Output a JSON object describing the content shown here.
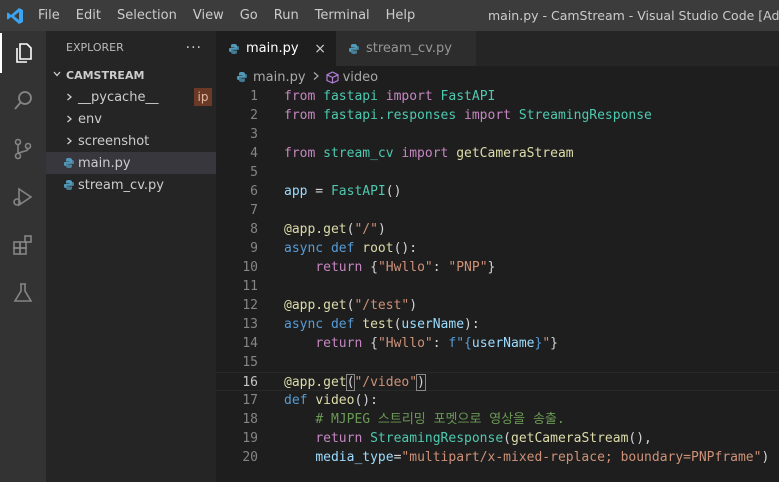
{
  "titlebar": {
    "menu": [
      "File",
      "Edit",
      "Selection",
      "View",
      "Go",
      "Run",
      "Terminal",
      "Help"
    ],
    "window_title": "main.py - CamStream - Visual Studio Code [Administrator]"
  },
  "activity_bar": {
    "items": [
      "explorer-icon",
      "search-icon",
      "source-control-icon",
      "run-debug-icon",
      "extensions-icon",
      "testing-icon"
    ],
    "active": "explorer-icon"
  },
  "explorer": {
    "title": "EXPLORER",
    "more": "···",
    "folder": "CAMSTREAM",
    "items": [
      {
        "label": "__pycache__",
        "type": "folder"
      },
      {
        "label": "env",
        "type": "folder"
      },
      {
        "label": "screenshot",
        "type": "folder"
      },
      {
        "label": "main.py",
        "type": "python"
      },
      {
        "label": "stream_cv.py",
        "type": "python"
      }
    ],
    "badge": "ip"
  },
  "tabs": [
    {
      "label": "main.py",
      "active": true,
      "close": "×"
    },
    {
      "label": "stream_cv.py",
      "active": false
    }
  ],
  "breadcrumb": {
    "file": "main.py",
    "symbol": "video"
  },
  "code": {
    "line_numbers": [
      "1",
      "2",
      "3",
      "4",
      "5",
      "6",
      "7",
      "8",
      "9",
      "10",
      "11",
      "12",
      "13",
      "14",
      "15",
      "16",
      "17",
      "18",
      "19",
      "20"
    ],
    "current_line": "16",
    "lines": [
      [
        {
          "t": "from",
          "c": "kw"
        },
        {
          "t": " fastapi ",
          "c": "mod"
        },
        {
          "t": "import",
          "c": "kw"
        },
        {
          "t": " FastAPI",
          "c": "mod"
        }
      ],
      [
        {
          "t": "from",
          "c": "kw"
        },
        {
          "t": " fastapi.responses ",
          "c": "mod"
        },
        {
          "t": "import",
          "c": "kw"
        },
        {
          "t": " StreamingResponse",
          "c": "mod"
        }
      ],
      [],
      [
        {
          "t": "from",
          "c": "kw"
        },
        {
          "t": " stream_cv ",
          "c": "mod"
        },
        {
          "t": "import",
          "c": "kw"
        },
        {
          "t": " getCameraStream",
          "c": "fn"
        }
      ],
      [],
      [
        {
          "t": "app",
          "c": "var"
        },
        {
          "t": " = ",
          "c": "pl"
        },
        {
          "t": "FastAPI",
          "c": "mod"
        },
        {
          "t": "()",
          "c": "pl"
        }
      ],
      [],
      [
        {
          "t": "@app.get",
          "c": "fn"
        },
        {
          "t": "(",
          "c": "pl"
        },
        {
          "t": "\"/\"",
          "c": "str"
        },
        {
          "t": ")",
          "c": "pl"
        }
      ],
      [
        {
          "t": "async",
          "c": "kwb"
        },
        {
          "t": " ",
          "c": "pl"
        },
        {
          "t": "def",
          "c": "kwb"
        },
        {
          "t": " ",
          "c": "pl"
        },
        {
          "t": "root",
          "c": "fn"
        },
        {
          "t": "():",
          "c": "pl"
        }
      ],
      [
        {
          "t": "    ",
          "c": "pl"
        },
        {
          "t": "return",
          "c": "kw"
        },
        {
          "t": " {",
          "c": "pl"
        },
        {
          "t": "\"Hwllo\"",
          "c": "str"
        },
        {
          "t": ": ",
          "c": "pl"
        },
        {
          "t": "\"PNP\"",
          "c": "str"
        },
        {
          "t": "}",
          "c": "pl"
        }
      ],
      [],
      [
        {
          "t": "@app.get",
          "c": "fn"
        },
        {
          "t": "(",
          "c": "pl"
        },
        {
          "t": "\"/test\"",
          "c": "str"
        },
        {
          "t": ")",
          "c": "pl"
        }
      ],
      [
        {
          "t": "async",
          "c": "kwb"
        },
        {
          "t": " ",
          "c": "pl"
        },
        {
          "t": "def",
          "c": "kwb"
        },
        {
          "t": " ",
          "c": "pl"
        },
        {
          "t": "test",
          "c": "fn"
        },
        {
          "t": "(",
          "c": "pl"
        },
        {
          "t": "userName",
          "c": "var"
        },
        {
          "t": "):",
          "c": "pl"
        }
      ],
      [
        {
          "t": "    ",
          "c": "pl"
        },
        {
          "t": "return",
          "c": "kw"
        },
        {
          "t": " {",
          "c": "pl"
        },
        {
          "t": "\"Hwllo\"",
          "c": "str"
        },
        {
          "t": ": ",
          "c": "pl"
        },
        {
          "t": "f\"",
          "c": "kwb"
        },
        {
          "t": "{",
          "c": "kwb"
        },
        {
          "t": "userName",
          "c": "var"
        },
        {
          "t": "}",
          "c": "kwb"
        },
        {
          "t": "\"",
          "c": "str"
        },
        {
          "t": "}",
          "c": "pl"
        }
      ],
      [],
      [
        {
          "t": "@app.get",
          "c": "fn"
        },
        {
          "t": "(",
          "c": "pl brk"
        },
        {
          "t": "\"/video\"",
          "c": "str"
        },
        {
          "t": ")",
          "c": "pl brk"
        }
      ],
      [
        {
          "t": "def",
          "c": "kwb"
        },
        {
          "t": " ",
          "c": "pl"
        },
        {
          "t": "video",
          "c": "fn"
        },
        {
          "t": "():",
          "c": "pl"
        }
      ],
      [
        {
          "t": "    ",
          "c": "pl"
        },
        {
          "t": "# MJPEG 스트리밍 포멧으로 영상을 송출.",
          "c": "cm"
        }
      ],
      [
        {
          "t": "    ",
          "c": "pl"
        },
        {
          "t": "return",
          "c": "kw"
        },
        {
          "t": " ",
          "c": "pl"
        },
        {
          "t": "StreamingResponse",
          "c": "mod"
        },
        {
          "t": "(",
          "c": "pl"
        },
        {
          "t": "getCameraStream",
          "c": "fn"
        },
        {
          "t": "(),",
          "c": "pl"
        }
      ],
      [
        {
          "t": "    ",
          "c": "pl"
        },
        {
          "t": "media_type",
          "c": "var"
        },
        {
          "t": "=",
          "c": "pl"
        },
        {
          "t": "\"multipart/x-mixed-replace; boundary=PNPframe\"",
          "c": "str"
        },
        {
          "t": ")",
          "c": "pl"
        }
      ]
    ]
  }
}
